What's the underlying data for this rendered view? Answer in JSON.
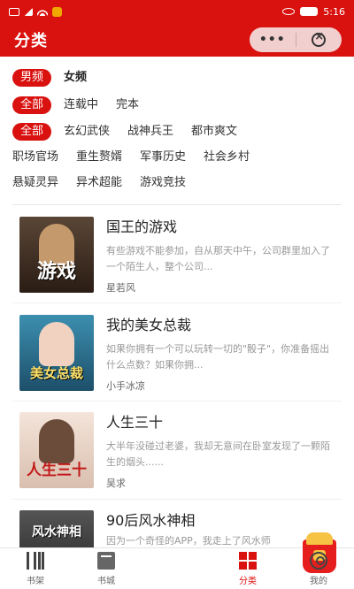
{
  "status_bar": {
    "time": "5:16"
  },
  "header": {
    "title": "分类",
    "more_label": "•••"
  },
  "filters": {
    "gender": {
      "selected": "男频",
      "other": "女频"
    },
    "status": {
      "selected": "全部",
      "options": [
        "连载中",
        "完本"
      ]
    },
    "genre": {
      "selected": "全部",
      "options": [
        "玄幻武侠",
        "战神兵王",
        "都市爽文",
        "职场官场",
        "重生赘婿",
        "军事历史",
        "社会乡村",
        "悬疑灵异",
        "异术超能",
        "游戏竞技"
      ]
    }
  },
  "books": [
    {
      "title": "国王的游戏",
      "desc": "有些游戏不能参加，自从那天中午，公司群里加入了一个陌生人，整个公司...",
      "author": "星若风",
      "cover_text": "游戏",
      "cover_color": "#3a2a22"
    },
    {
      "title": "我的美女总裁",
      "desc": "如果你拥有一个可以玩转一切的\"骰子\"，你准备摇出什么点数？如果你拥...",
      "author": "小手冰凉",
      "cover_text": "美女总裁",
      "cover_color": "#2a6f8c"
    },
    {
      "title": "人生三十",
      "desc": "大半年没碰过老婆，我却无意间在卧室发现了一颗陌生的烟头......",
      "author": "吴求",
      "cover_text": "人生三十",
      "cover_color": "#e8cfc0"
    },
    {
      "title": "90后风水神相",
      "desc": "因为一个奇怪的APP，我走上了风水师",
      "author": "",
      "cover_text": "风水神相",
      "cover_color": "#3b3b3b"
    }
  ],
  "tabbar": {
    "tabs": [
      {
        "label": "书架"
      },
      {
        "label": "书城"
      },
      {
        "label": ""
      },
      {
        "label": "分类"
      },
      {
        "label": "我的"
      }
    ]
  },
  "colors": {
    "brand": "#d9120f"
  }
}
